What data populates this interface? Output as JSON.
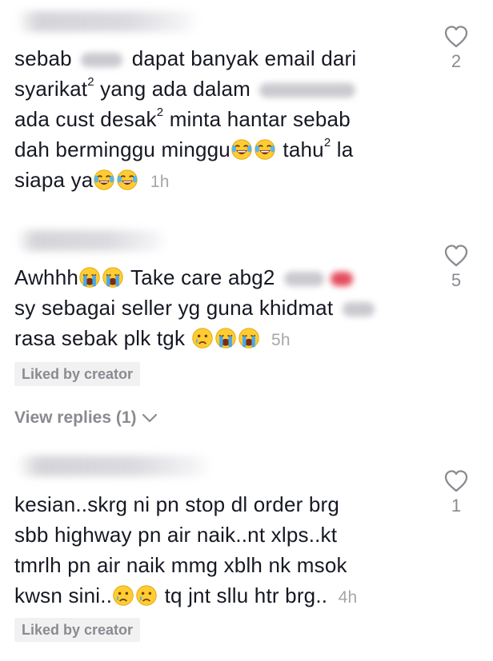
{
  "comments": [
    {
      "lines": [
        [
          "sebab",
          "dapat banyak email dari"
        ],
        [
          "syarikat",
          "2",
          "yang ada dalam"
        ],
        [
          "ada cust desak",
          "2",
          "minta hantar sebab"
        ],
        [
          "dah berminggu minggu",
          "tahu",
          "2",
          "la"
        ],
        [
          "siapa ya"
        ]
      ],
      "time": "1h",
      "likes": "2"
    },
    {
      "lines": [
        [
          "Awhhh",
          "Take care abg2"
        ],
        [
          "sy sebagai seller yg guna khidmat"
        ],
        [
          "rasa sebak plk tgk"
        ]
      ],
      "time": "5h",
      "likes": "5",
      "liked_label": "Liked by creator",
      "view_replies_label": "View replies (1)"
    },
    {
      "lines": [
        [
          "kesian..skrg ni pn stop dl order brg"
        ],
        [
          "sbb highway pn air naik..nt xlps..kt"
        ],
        [
          "tmrlh pn air naik mmg xblh nk msok"
        ],
        [
          "kwsn sini..",
          "tq jnt sllu htr brg.."
        ]
      ],
      "time": "4h",
      "likes": "1",
      "liked_label": "Liked by creator"
    }
  ],
  "icons": {
    "heart": "heart-outline-icon",
    "laugh_emoji": "face-with-tears-of-joy-icon",
    "cry_emoji": "loudly-crying-face-icon",
    "sad_emoji": "crying-face-icon",
    "chevron": "chevron-down-icon"
  },
  "colors": {
    "text": "#161823",
    "muted": "#8a8b91",
    "badge_bg": "#f1f1f2"
  }
}
